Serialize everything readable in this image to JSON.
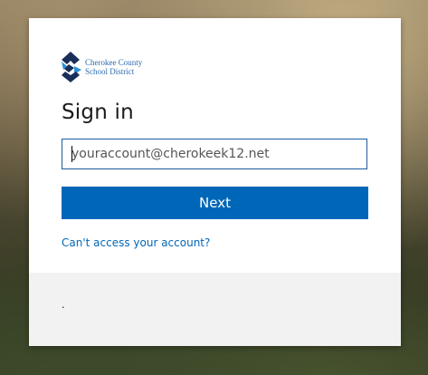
{
  "org": {
    "name_line1": "Cherokee County",
    "name_line2": "School District",
    "logo_icon": "cherokee-county-logo-icon"
  },
  "signin": {
    "title": "Sign in",
    "email_placeholder": "youraccount@cherokeek12.net",
    "email_value": "",
    "next_label": "Next",
    "cant_access_label": "Can't access your account?"
  },
  "footer": {
    "text": "."
  },
  "colors": {
    "primary": "#0067b8",
    "input_border": "#1d5c9e",
    "logo_blue": "#2b6cb0",
    "logo_dark": "#1a2e5a",
    "footer_bg": "#f2f2f2"
  }
}
